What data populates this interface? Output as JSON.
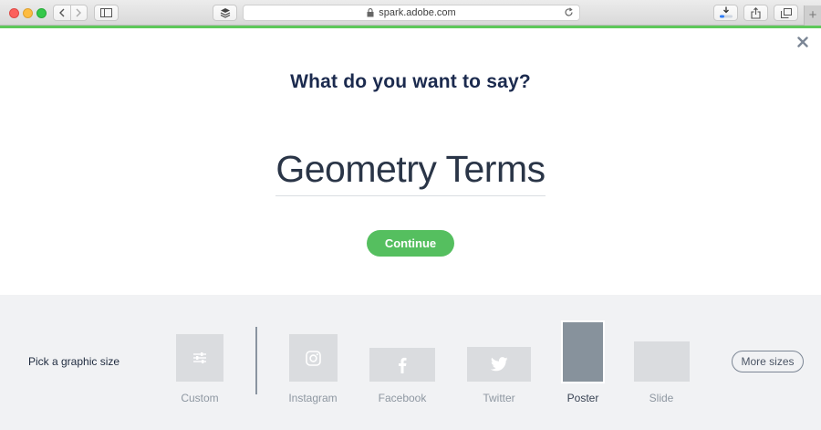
{
  "browser": {
    "url": "spark.adobe.com",
    "icons": [
      "back-icon",
      "forward-icon",
      "sidebar-icon",
      "layers-icon",
      "lock-icon",
      "reload-icon",
      "download-icon",
      "share-icon",
      "tabs-icon"
    ],
    "new_tab_label": "+"
  },
  "dialog": {
    "heading": "What do you want to say?",
    "title_value": "Geometry Terms",
    "continue_label": "Continue",
    "close_icon": "close-icon"
  },
  "size_picker": {
    "label": "Pick a graphic size",
    "options": [
      {
        "label": "Custom",
        "icon": "sliders-icon",
        "selected": false
      },
      {
        "label": "Instagram",
        "icon": "instagram-icon",
        "selected": false
      },
      {
        "label": "Facebook",
        "icon": "facebook-icon",
        "selected": false
      },
      {
        "label": "Twitter",
        "icon": "twitter-icon",
        "selected": false
      },
      {
        "label": "Poster",
        "icon": "",
        "selected": true
      },
      {
        "label": "Slide",
        "icon": "",
        "selected": false
      }
    ],
    "more_label": "More sizes"
  },
  "colors": {
    "accent_green": "#55bf5f",
    "heading_navy": "#1b2a4e",
    "selected_thumb": "#87929c",
    "thumb_gray": "#dadcdf"
  }
}
